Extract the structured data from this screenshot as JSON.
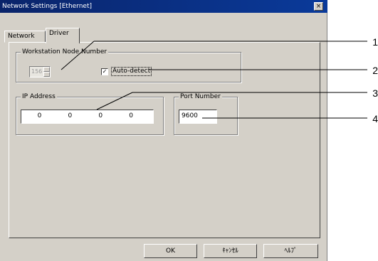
{
  "window": {
    "title": "Network Settings [Ethernet]",
    "close": "×"
  },
  "tabs": [
    {
      "label": "Network"
    },
    {
      "label": "Driver"
    }
  ],
  "workstation": {
    "group_label": "Workstation Node Number",
    "node_value": "156",
    "auto_detect_label": "Auto-detect",
    "auto_detect_checked": "✓"
  },
  "ip": {
    "group_label": "IP Address",
    "octets": [
      "0",
      "0",
      "0",
      "0"
    ]
  },
  "port": {
    "group_label": "Port Number",
    "value": "9600"
  },
  "buttons": {
    "ok": "OK",
    "cancel": "ｷｬﾝｾﾙ",
    "help": "ﾍﾙﾌﾟ"
  },
  "callouts": [
    "1",
    "2",
    "3",
    "4"
  ]
}
